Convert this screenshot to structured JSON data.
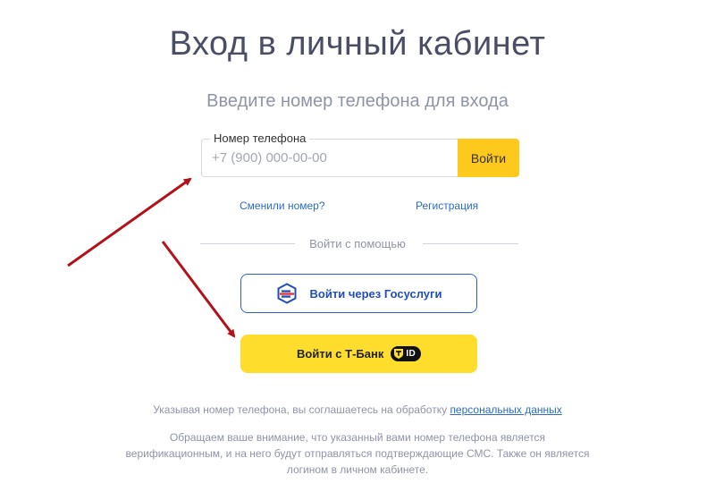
{
  "page": {
    "title": "Вход в личный кабинет",
    "subtitle": "Введите номер телефона для входа"
  },
  "phone_form": {
    "label": "Номер телефона",
    "placeholder": "+7 (900) 000-00-00",
    "value": "",
    "submit_label": "Войти"
  },
  "links": {
    "changed_number": "Сменили номер?",
    "register": "Регистрация"
  },
  "alt_login": {
    "divider_text": "Войти с помощью",
    "gosuslugi_label": "Войти через Госуслуги",
    "tbank_label": "Войти с Т-Банк",
    "tbank_badge": "ID"
  },
  "consent": {
    "text": "Указывая номер телефона, вы соглашаетесь на обработку ",
    "link_text": "персональных данных"
  },
  "notice": {
    "text": "Обращаем ваше внимание, что указанный вами номер телефона является верификационным, и на него будут отправляться подтверждающие СМС. Также он является логином в личном кабинете."
  },
  "colors": {
    "primary_yellow": "#fdc91c",
    "tbank_yellow": "#ffdd2d",
    "link_blue": "#2b6cc4",
    "gosuslugi_blue": "#2d5ed1",
    "annotation_arrow": "#b3121a"
  },
  "icons": {
    "gosuslugi": "gosuslugi-logo-icon",
    "tbank": "tbank-shield-icon"
  }
}
